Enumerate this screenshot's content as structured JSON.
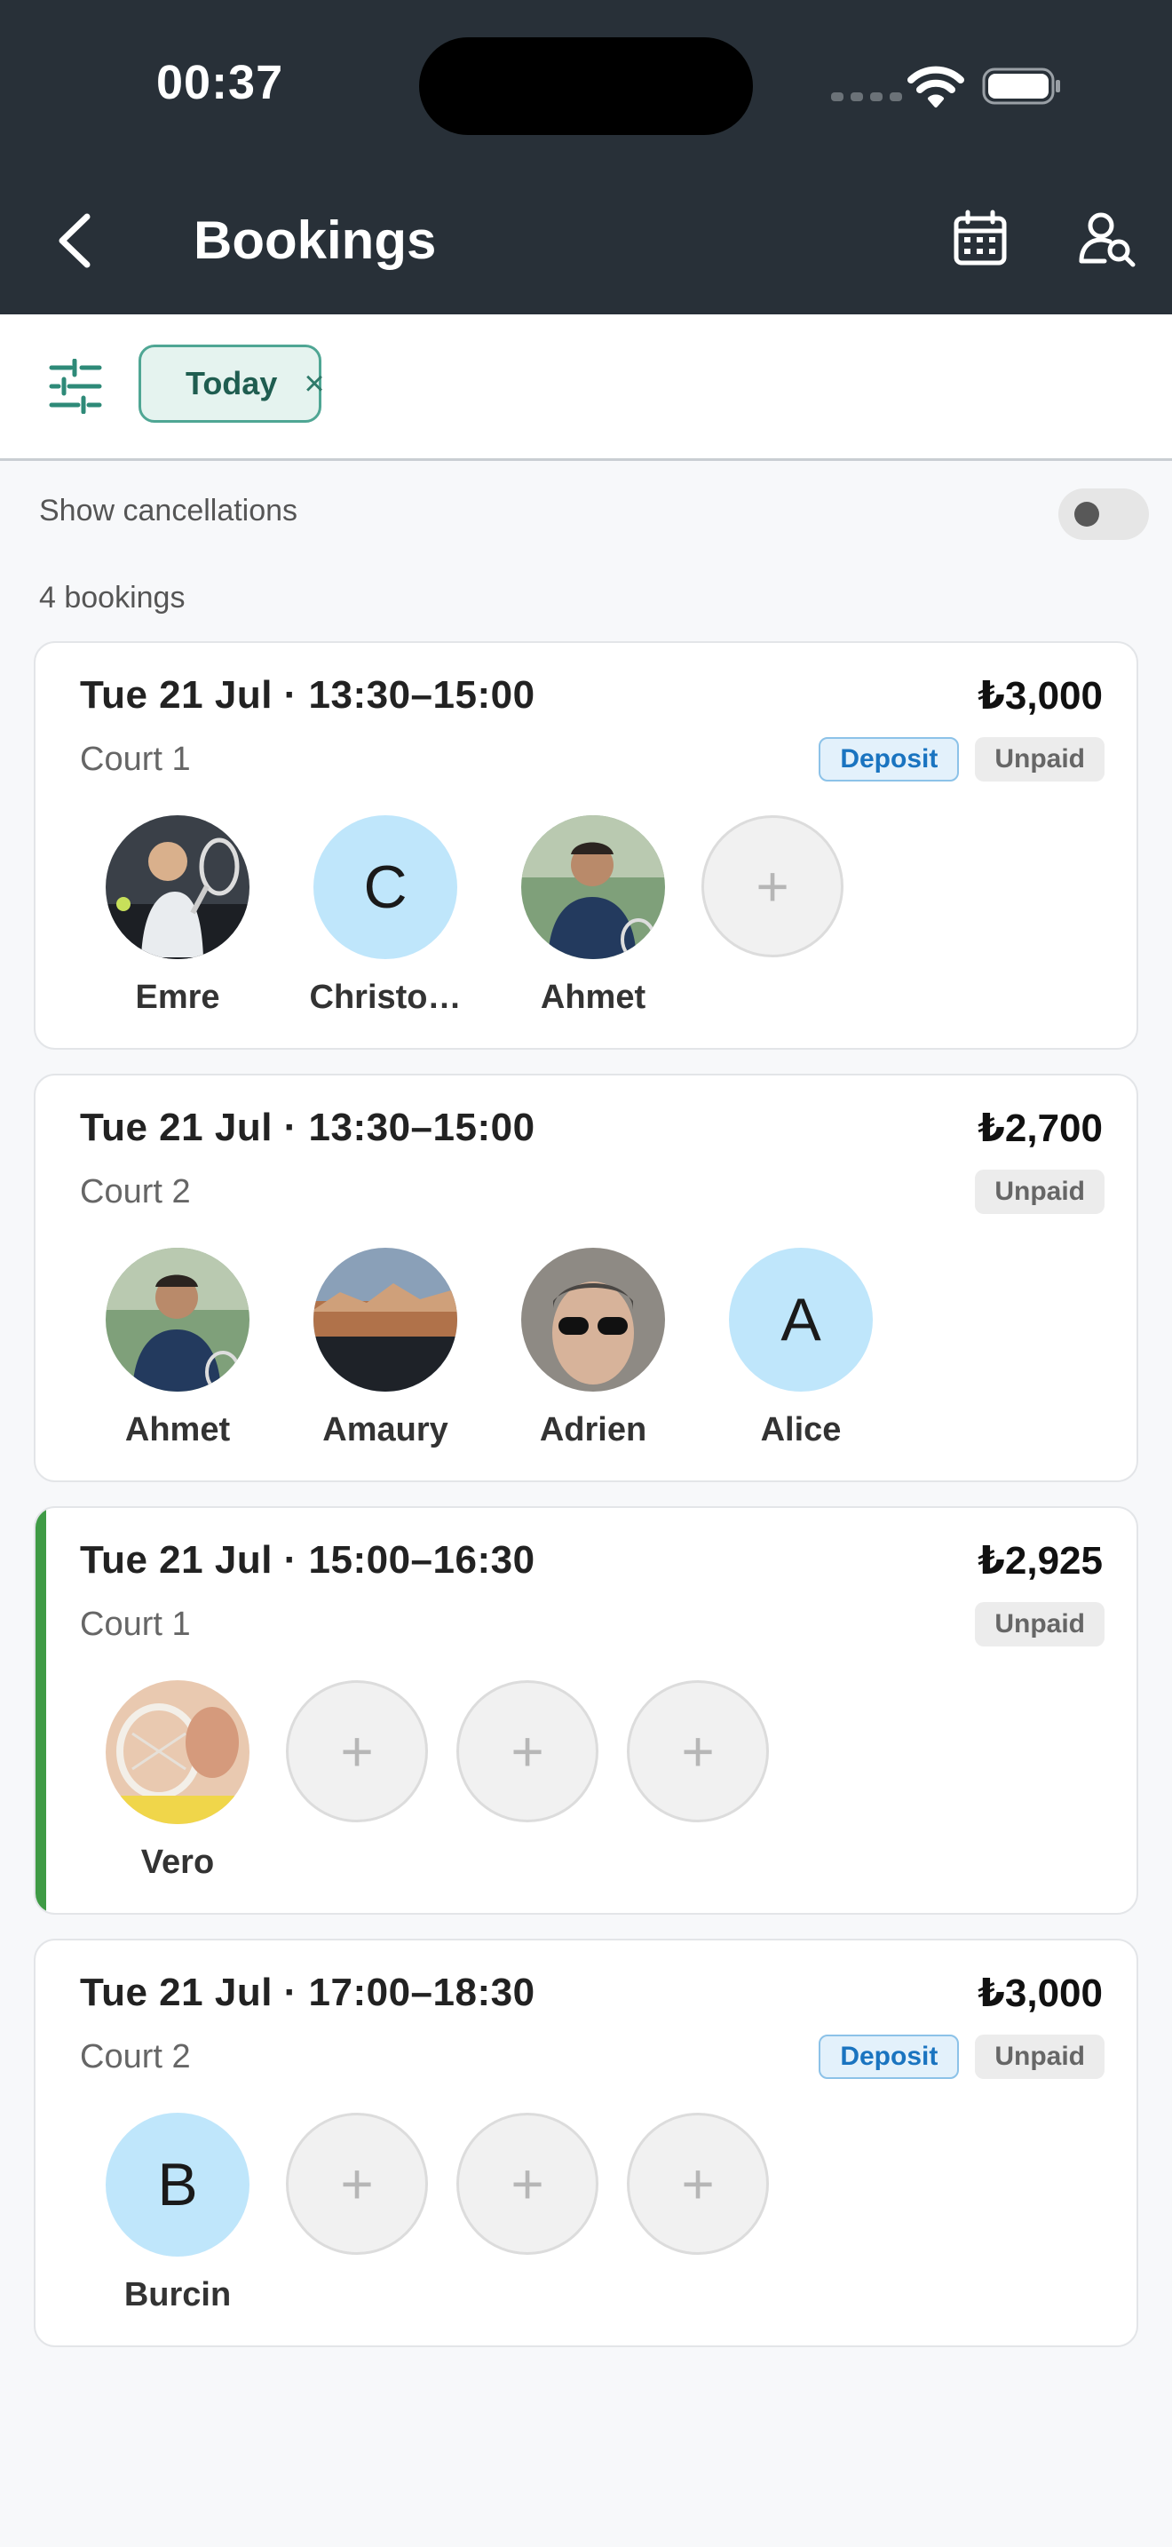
{
  "status": {
    "time": "00:37"
  },
  "header": {
    "title": "Bookings"
  },
  "filters": {
    "chip_label": "Today",
    "chip_close": "×"
  },
  "toggle_label": "Show cancellations",
  "bookings_count": "4 bookings",
  "add_glyph": "+",
  "bookings": [
    {
      "when": "Tue 21 Jul · 13:30–15:00",
      "price": "₺3,000",
      "court": "Court 1",
      "deposit": "Deposit",
      "unpaid": "Unpaid",
      "players": [
        {
          "name": "Emre"
        },
        {
          "name": "Christo…",
          "initial": "C"
        },
        {
          "name": "Ahmet"
        }
      ]
    },
    {
      "when": "Tue 21 Jul · 13:30–15:00",
      "price": "₺2,700",
      "court": "Court 2",
      "unpaid": "Unpaid",
      "players": [
        {
          "name": "Ahmet"
        },
        {
          "name": "Amaury"
        },
        {
          "name": "Adrien"
        },
        {
          "name": "Alice",
          "initial": "A"
        }
      ]
    },
    {
      "when": "Tue 21 Jul · 15:00–16:30",
      "price": "₺2,925",
      "court": "Court 1",
      "unpaid": "Unpaid",
      "players": [
        {
          "name": "Vero"
        }
      ]
    },
    {
      "when": "Tue 21 Jul · 17:00–18:30",
      "price": "₺3,000",
      "court": "Court 2",
      "deposit": "Deposit",
      "unpaid": "Unpaid",
      "players": [
        {
          "name": "Burcin",
          "initial": "B"
        }
      ]
    }
  ]
}
